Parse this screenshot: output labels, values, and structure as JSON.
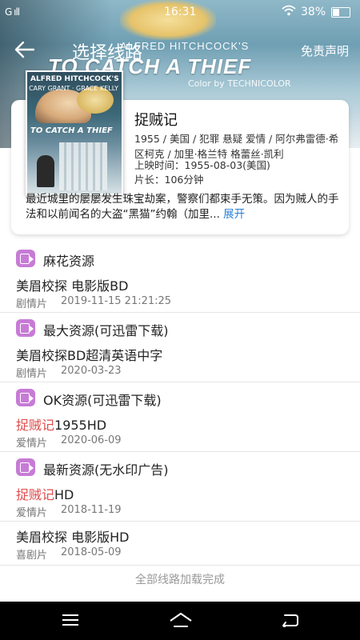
{
  "status_bar": {
    "time": "16:31",
    "battery": "38%",
    "signal": "G ıll"
  },
  "header": {
    "title": "选择线路",
    "disclaimer": "免责声明",
    "banner_line1": "ALFRED HITCHCOCK'S",
    "banner_title": "TO CATCH A THIEF",
    "banner_line3": "Color by TECHNICOLOR"
  },
  "poster": {
    "head": "ALFRED HITCHCOCK'S",
    "cast": "CARY GRANT · GRACE KELLY",
    "title": "TO CATCH A THIEF"
  },
  "movie": {
    "title": "捉贼记",
    "meta": "1955 / 美国 / 犯罪 悬疑 爱情 / 阿尔弗雷德·希区柯克 / 加里·格兰特 格蕾丝·凯利",
    "release": "上映时间：1955-08-03(美国)",
    "duration": "片长：106分钟",
    "synopsis": "最近城里的屡屡发生珠宝劫案，警察们都束手无策。因为贼人的手法和以前闻名的大盗“黑猫”约翰（加里...",
    "expand_label": "展开"
  },
  "sources": [
    {
      "name": "麻花资源",
      "item": {
        "title_pre": "",
        "title_hl": "",
        "title_post": "美眉校探 电影版BD",
        "genre": "剧情片",
        "date": "2019-11-15 21:21:25"
      }
    },
    {
      "name": "最大资源(可迅雷下载)",
      "item": {
        "title_pre": "",
        "title_hl": "",
        "title_post": "美眉校探BD超清英语中字",
        "genre": "剧情片",
        "date": "2020-03-23"
      }
    },
    {
      "name": "OK资源(可迅雷下载)",
      "item": {
        "title_pre": "",
        "title_hl": "捉贼记",
        "title_post": "1955HD",
        "genre": "爱情片",
        "date": "2020-06-09"
      }
    },
    {
      "name": "最新资源(无水印广告)",
      "item": {
        "title_pre": "",
        "title_hl": "捉贼记",
        "title_post": "HD",
        "genre": "爱情片",
        "date": "2018-11-19"
      }
    }
  ],
  "extra_item": {
    "title": "美眉校探 电影版HD",
    "genre": "喜剧片",
    "date": "2018-05-09"
  },
  "footer_note": "全部线路加载完成",
  "colors": {
    "highlight": "#e04c4c",
    "link": "#2c82d8",
    "source_icon": "#c77bd6"
  }
}
